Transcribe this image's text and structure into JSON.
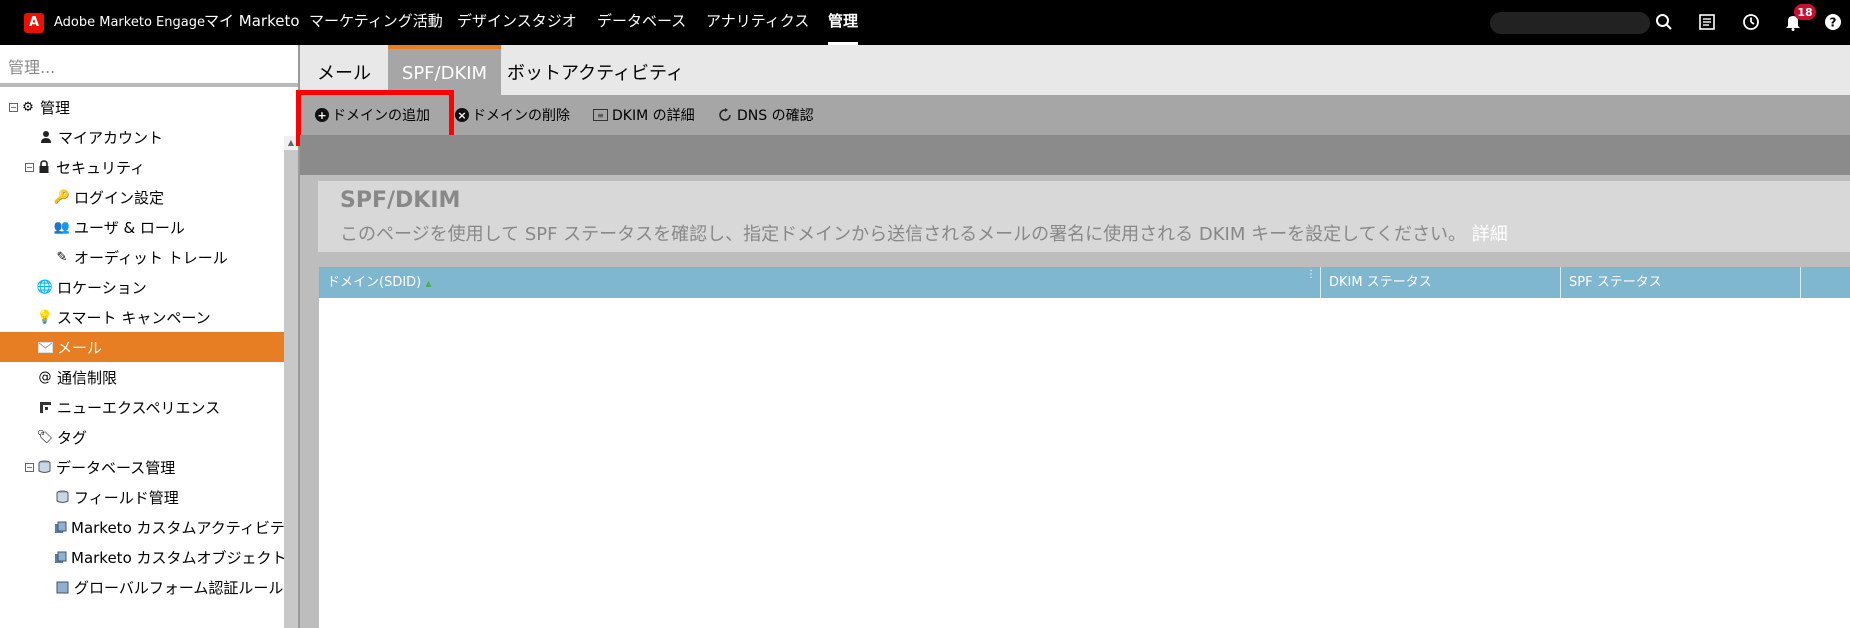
{
  "topnav": {
    "brand": "Adobe Marketo Engage",
    "items": [
      "マイ Marketo",
      "マーケティング活動",
      "デザインスタジオ",
      "データベース",
      "アナリティクス",
      "管理"
    ],
    "notification_count": "18"
  },
  "sidebar": {
    "search_placeholder": "管理...",
    "items": [
      {
        "label": "管理",
        "icon": "gear-icon"
      },
      {
        "label": "マイアカウント",
        "icon": "person-icon"
      },
      {
        "label": "セキュリティ",
        "icon": "lock-icon"
      },
      {
        "label": "ログイン設定",
        "icon": "key-icon"
      },
      {
        "label": "ユーザ & ロール",
        "icon": "users-icon"
      },
      {
        "label": "オーディット トレール",
        "icon": "audit-icon"
      },
      {
        "label": "ロケーション",
        "icon": "globe-icon"
      },
      {
        "label": "スマート キャンペーン",
        "icon": "lightbulb-icon"
      },
      {
        "label": "メール",
        "icon": "email-icon"
      },
      {
        "label": "通信制限",
        "icon": "at-icon"
      },
      {
        "label": "ニューエクスペリエンス",
        "icon": "new-experience-icon"
      },
      {
        "label": "タグ",
        "icon": "tag-icon"
      },
      {
        "label": "データベース管理",
        "icon": "database-icon"
      },
      {
        "label": "フィールド管理",
        "icon": "database-icon"
      },
      {
        "label": "Marketo カスタムアクティビティ",
        "icon": "custom-activity-icon"
      },
      {
        "label": "Marketo カスタムオブジェクト",
        "icon": "custom-object-icon"
      },
      {
        "label": "グローバルフォーム認証ルール",
        "icon": "form-rule-icon"
      }
    ]
  },
  "tabs": [
    "メール",
    "SPF/DKIM",
    "ボットアクティビティ"
  ],
  "toolbar": {
    "add_domain": "ドメインの追加",
    "delete_domain": "ドメインの削除",
    "dkim_details": "DKIM の詳細",
    "dns_check": "DNS の確認"
  },
  "info": {
    "title": "SPF/DKIM",
    "description": "このページを使用して SPF ステータスを確認し、指定ドメインから送信されるメールの署名に使用される DKIM キーを設定してください。",
    "link": "詳細"
  },
  "grid": {
    "columns": [
      "ドメイン(SDID)",
      "DKIM ステータス",
      "SPF ステータス"
    ]
  },
  "colors": {
    "accent": "#e87e24",
    "grid_header": "#7fb7d1",
    "highlight": "#ff0000"
  }
}
